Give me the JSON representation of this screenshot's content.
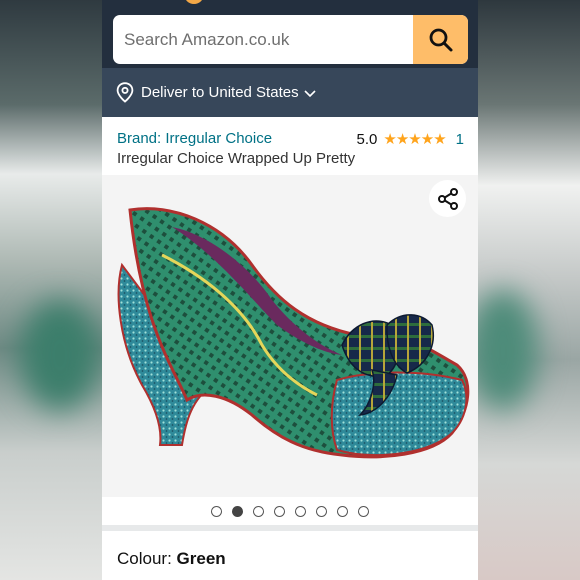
{
  "search": {
    "placeholder": "Search Amazon.co.uk"
  },
  "delivery": {
    "label": "Deliver to United States"
  },
  "product": {
    "brand": "Brand: Irregular Choice",
    "rating_value": "5.0",
    "stars": "★★★★★",
    "rating_count": "1",
    "title": "Irregular Choice Wrapped Up Pretty"
  },
  "gallery": {
    "image_count": 8,
    "active_index": 1
  },
  "colour": {
    "label": "Colour:",
    "value": "Green"
  },
  "colors": {
    "nav_dark": "#232f3e",
    "nav_secondary": "#37475a",
    "search_button": "#febd69",
    "link": "#007185",
    "star": "#ffa41c"
  },
  "icons": [
    "search-icon",
    "location-pin-icon",
    "chevron-down-icon",
    "share-icon"
  ]
}
